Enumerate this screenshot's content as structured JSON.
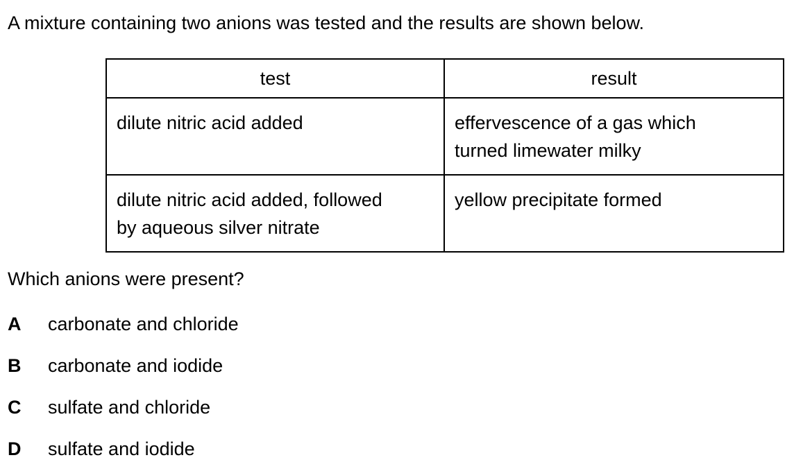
{
  "intro": "A mixture containing two anions was tested and the results are shown below.",
  "table": {
    "headers": [
      "test",
      "result"
    ],
    "rows": [
      {
        "test": [
          "dilute nitric acid added"
        ],
        "result": [
          "effervescence of a gas which",
          "turned limewater milky"
        ]
      },
      {
        "test": [
          "dilute nitric acid added, followed",
          "by aqueous silver nitrate"
        ],
        "result": [
          "yellow precipitate formed"
        ]
      }
    ]
  },
  "question": "Which anions were present?",
  "options": [
    {
      "letter": "A",
      "text": "carbonate and chloride"
    },
    {
      "letter": "B",
      "text": "carbonate and iodide"
    },
    {
      "letter": "C",
      "text": "sulfate and chloride"
    },
    {
      "letter": "D",
      "text": "sulfate and iodide"
    }
  ]
}
